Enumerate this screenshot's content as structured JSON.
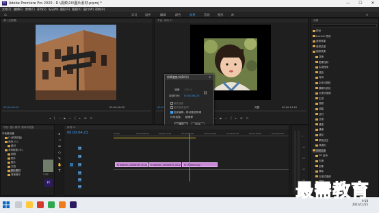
{
  "titlebar": {
    "logo_text": "Pr",
    "title": "Adobe Premiere Pro 2020 - D:\\视频\\10\\图片素材.prproj *",
    "min_icon": "—",
    "max_icon": "☐",
    "close_icon": "✕"
  },
  "menu": [
    "文件(F)",
    "编辑(E)",
    "剪辑(C)",
    "序列(S)",
    "标记(M)",
    "图形(G)",
    "视图(V)",
    "窗口(W)",
    "帮助(H)"
  ],
  "workspaces": [
    "学习",
    "组件",
    "编辑",
    "颜色",
    "效果",
    "音频",
    "图形",
    "库"
  ],
  "workspace_active": "效果",
  "source": {
    "tab": "源: (无剪辑)",
    "timecode_left": "00:00:00:00",
    "timecode_right": "00:00:00:00"
  },
  "program": {
    "tab": "节目: 序列 01",
    "timecode_left": "00:00:04:23",
    "fit": "适合",
    "quality": "完整",
    "timecode_right": "00:00:14:18"
  },
  "dialog": {
    "title": "剪辑速度/持续时间",
    "speed_label": "速度:",
    "speed_value": "100 %",
    "duration_label": "持续时间:",
    "duration_value": "00:00:04:23",
    "reverse_label": "倒放速度",
    "pitch_label": "保持音频音调",
    "ripple_label": "波纹编辑，移动尾部剪辑",
    "interp_label": "时间插值:",
    "interp_value": "帧采样",
    "ok": "确定",
    "cancel": "取消"
  },
  "project": {
    "tab": "项目: 图片素材",
    "tab2": "媒体浏览器",
    "tab3": "效果控件",
    "tree": [
      "本地驱动器",
      "C:(系统保留)",
      "系统 (C:)",
      "素材",
      "本地磁盘 (D:)",
      "视频",
      "图片",
      "照片",
      "文档",
      "图片素材",
      "背景音乐"
    ],
    "thumb_caption": "2.jpg"
  },
  "timeline": {
    "tab": "序列 01",
    "timecode": "00:00:04:23",
    "ruler": [
      "00:00",
      "00:00:05:00",
      "00:00:10:00",
      "00:00:15:00",
      "00:00:20:00",
      "00:00:25:00",
      "00:00:30:00",
      "00:00:35:00"
    ],
    "tracks_video": [
      "V3",
      "V2",
      "V1"
    ],
    "tracks_audio": [
      "A1",
      "A2",
      "A3"
    ],
    "clips": [
      "fx  wbcam_20200325_01.jpg",
      "fx  wbcam_20200325_02.jpg",
      "fx  children.jpg"
    ]
  },
  "effects": {
    "tab": "效果",
    "items": [
      "预设",
      "Lumetri 预设",
      "音频效果",
      "音频过渡",
      "视频效果",
      "变换",
      "图像控制",
      "实用程序",
      "扭曲",
      "时间",
      "杂色与颗粒",
      "模糊与锐化",
      "沉浸式视频",
      "生成",
      "视频",
      "调整",
      "过时",
      "过渡",
      "透视",
      "通道",
      "键控",
      "颜色校正",
      "风格化",
      "视频过渡",
      "3D 运动",
      "内滑",
      "划像",
      "擦除",
      "沉浸式视频",
      "溶解",
      "缩放",
      "页面剥落"
    ]
  },
  "meters": {
    "labels": [
      "0",
      "-12",
      "-24",
      "-36",
      "-48",
      "dB"
    ]
  },
  "taskbar": {
    "time": "9:18",
    "date": "2021/11/15"
  },
  "watermark": "最需教育",
  "colors": {
    "accent": "#3b9cf5",
    "clip": "#c98bd7",
    "panel": "#1f1f1f",
    "bg": "#1d1d1d"
  }
}
